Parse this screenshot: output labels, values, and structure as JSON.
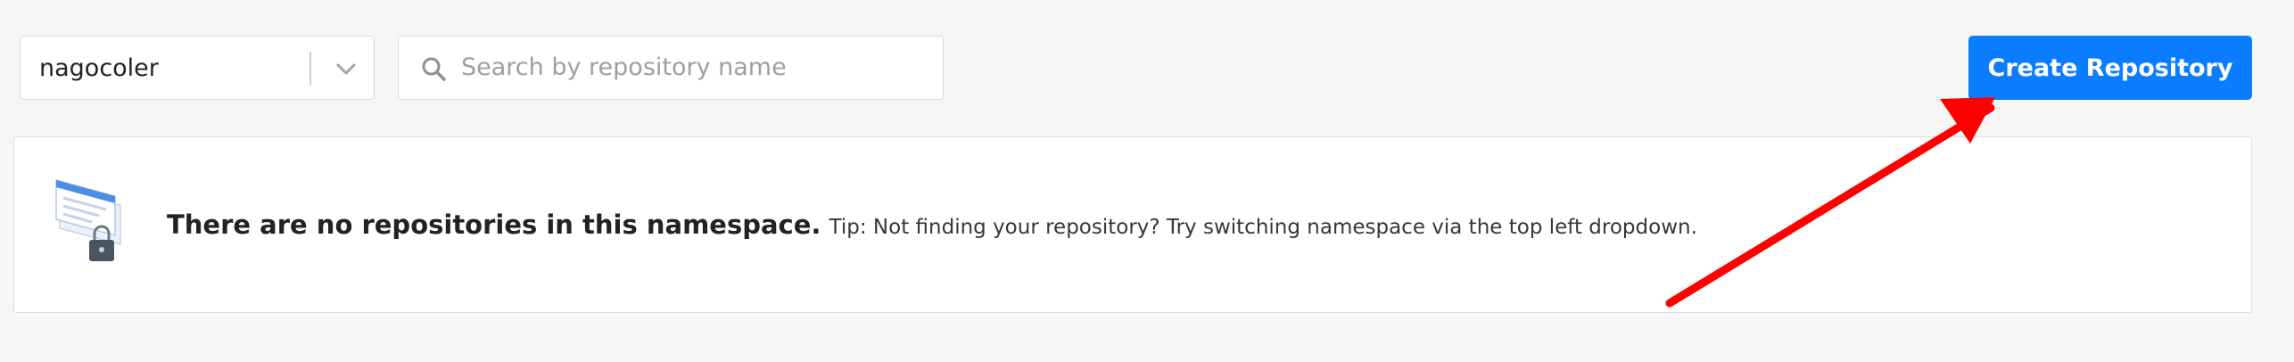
{
  "namespace_selector": {
    "value": "nagocoler",
    "icon": "chevron-down-icon"
  },
  "search": {
    "placeholder": "Search by repository name",
    "value": "",
    "icon": "search-icon"
  },
  "create_button": {
    "label": "Create Repository",
    "color": "#0a7cff"
  },
  "empty_state": {
    "title": "There are no repositories in this namespace.",
    "tip": "Tip: Not finding your repository? Try switching namespace via the top left dropdown.",
    "illustration": "repository-lock-icon"
  },
  "annotation": {
    "type": "arrow",
    "color": "#ff0000",
    "points_to": "create_button"
  }
}
